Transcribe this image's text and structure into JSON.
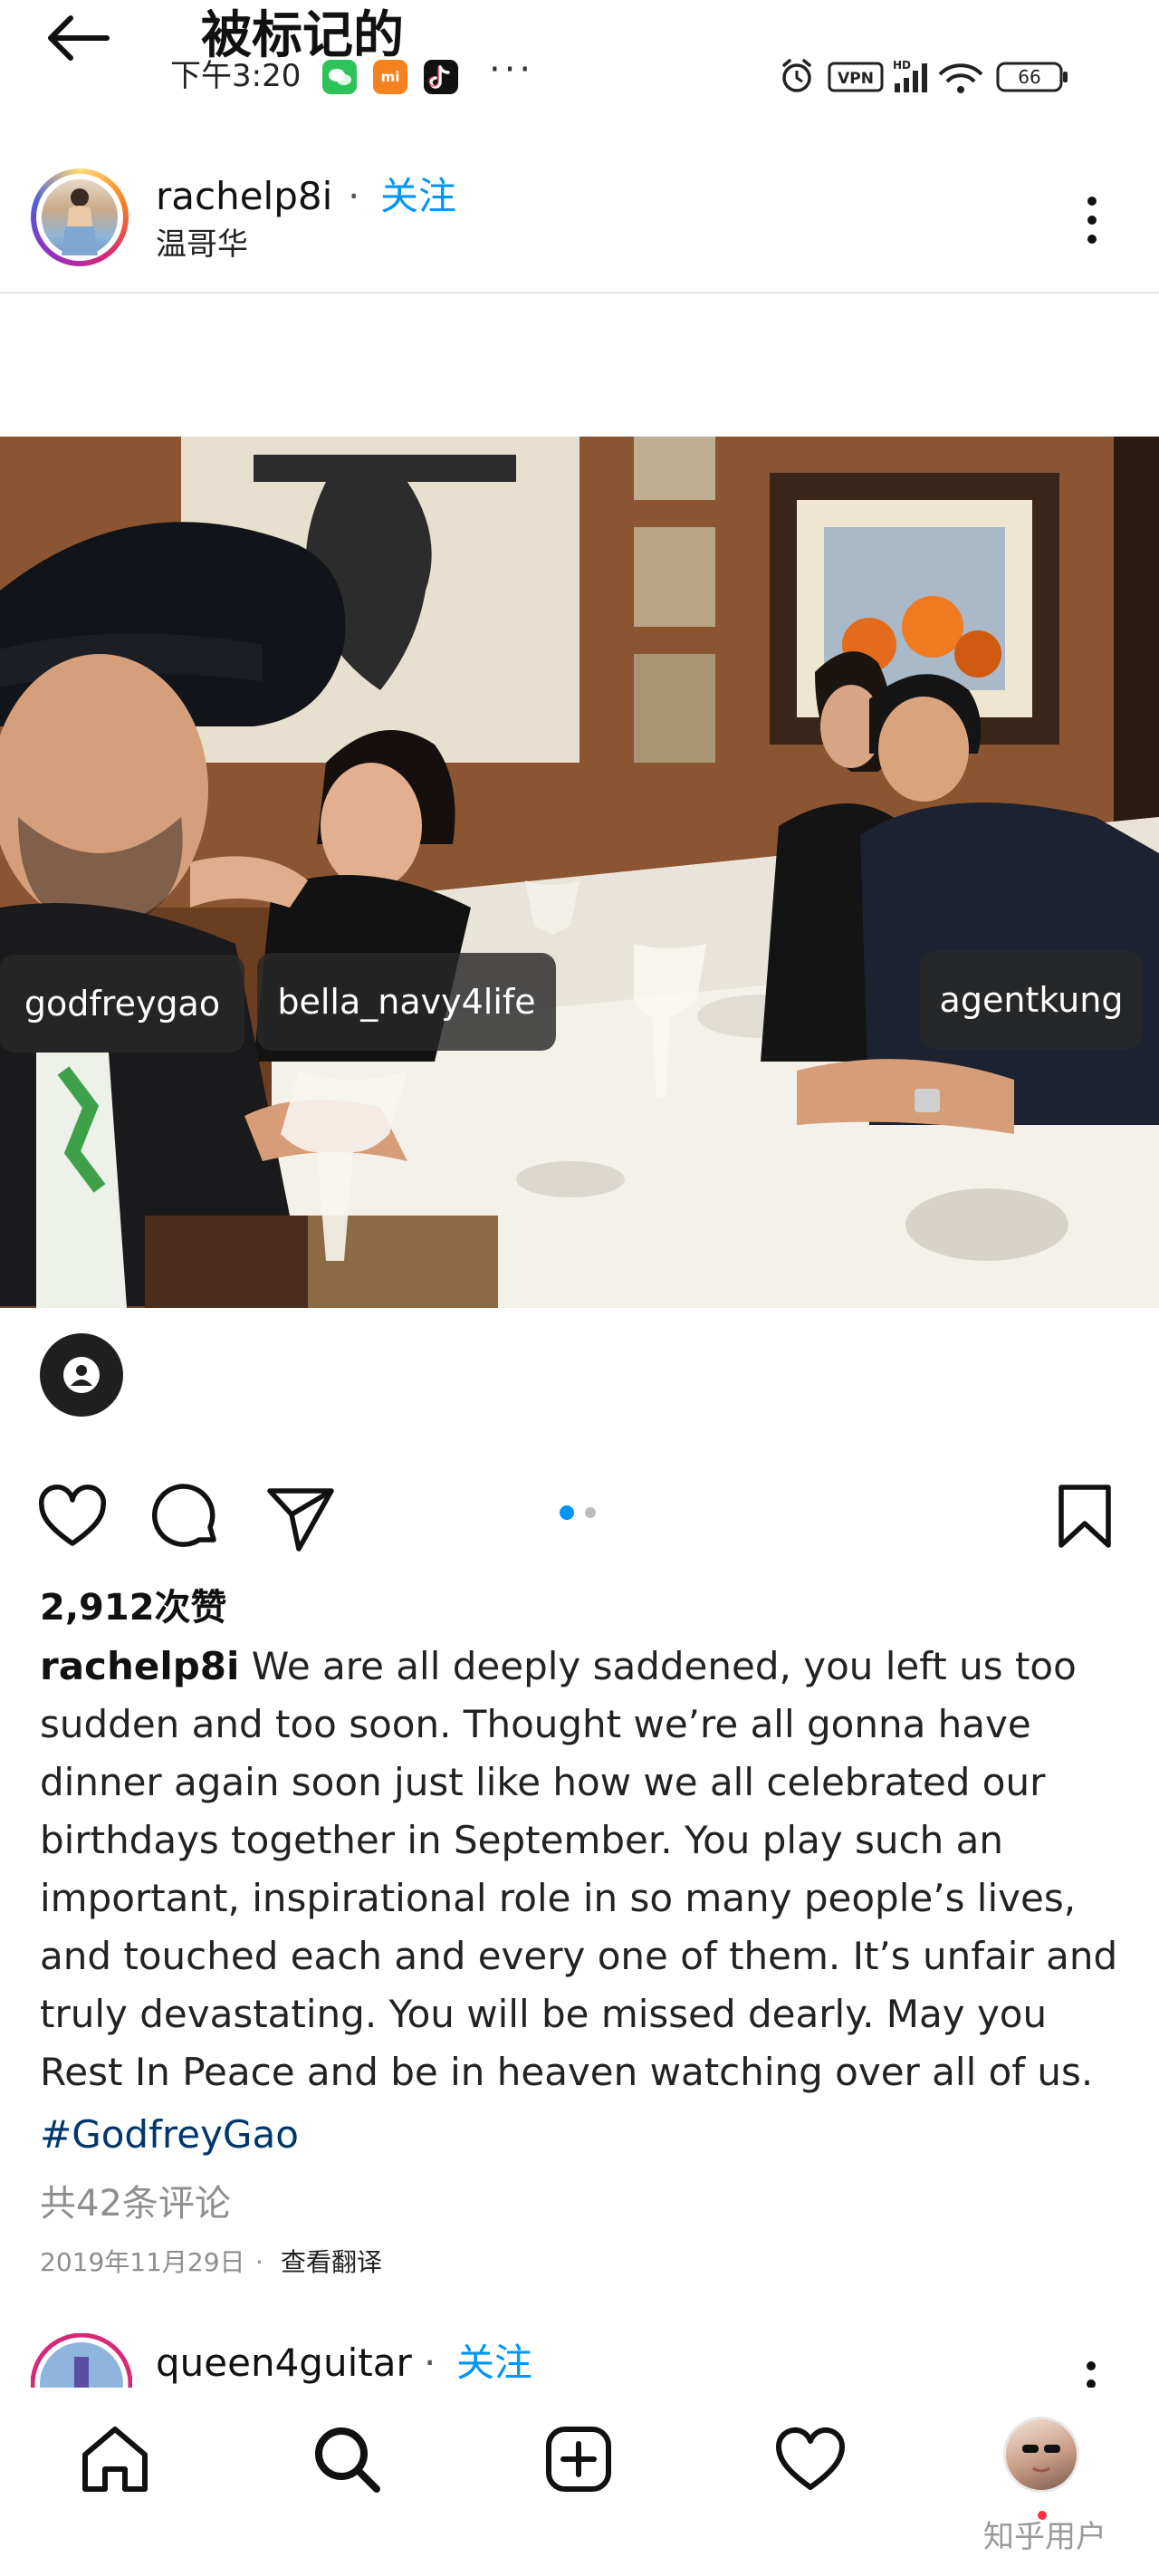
{
  "top_bar": {
    "title": "被标记的",
    "time": "下午3:20",
    "more": "···",
    "mi_badge": "mi",
    "battery": "66",
    "hd_label": "HD",
    "vpn_label": "VPN"
  },
  "post": {
    "username": "rachelp8i",
    "separator": "·",
    "follow_label": "关注",
    "location": "温哥华",
    "tags": [
      "godfreygao",
      "bella_navy4life",
      "agentkung"
    ],
    "likes": "2,912次赞",
    "caption_user": "rachelp8i",
    "caption_text": "We are all deeply saddened, you left us too sudden and too soon. Thought we’re all gonna have dinner again soon just like how we all celebrated our birthdays together in September. You play such an important, inspirational role in so many people’s lives, and touched each and every one of them. It’s unfair and truly devastating. You will be missed dearly. May you Rest In Peace and be in heaven watching over all of us.",
    "hashtag": "#GodfreyGao",
    "comments": "共42条评论",
    "date": "2019年11月29日",
    "date_separator": "·",
    "translate_label": "查看翻译",
    "carousel": {
      "count": 2,
      "active_index": 1
    }
  },
  "next_post": {
    "username": "queen4guitar",
    "separator": "·",
    "follow_label": "关注"
  },
  "watermark": "知乎用户",
  "icons": {
    "back": "arrow-left-icon",
    "more": "vertical-dots-icon",
    "like": "heart-icon",
    "comment": "speech-bubble-icon",
    "share": "paper-plane-icon",
    "save": "bookmark-icon",
    "home": "home-icon",
    "search": "magnifier-icon",
    "create": "plus-square-icon",
    "activity": "heart-icon",
    "tags": "person-icon"
  },
  "colors": {
    "accent": "#0095f6",
    "hashtag": "#00376b",
    "muted": "#8e8e8e"
  }
}
